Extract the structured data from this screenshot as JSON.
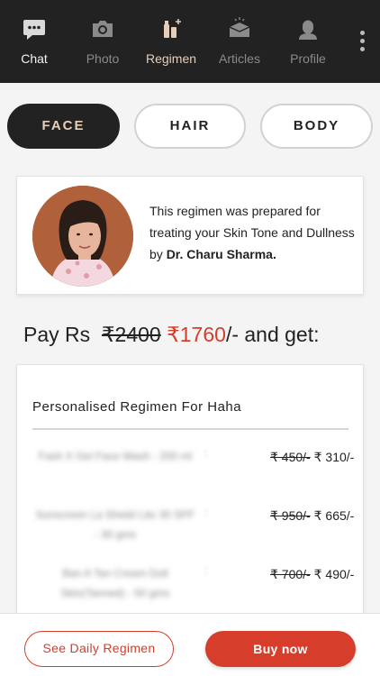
{
  "topnav": {
    "items": [
      {
        "label": "Chat",
        "icon": "chat-icon",
        "active": false
      },
      {
        "label": "Photo",
        "icon": "camera-icon",
        "active": false
      },
      {
        "label": "Regimen",
        "icon": "regimen-icon",
        "active": true
      },
      {
        "label": "Articles",
        "icon": "articles-icon",
        "active": false
      },
      {
        "label": "Profile",
        "icon": "profile-icon",
        "active": false
      }
    ],
    "menu_icon": "kebab-menu-icon"
  },
  "tabs": [
    {
      "label": "FACE",
      "selected": true
    },
    {
      "label": "HAIR",
      "selected": false
    },
    {
      "label": "BODY",
      "selected": false
    }
  ],
  "doctor": {
    "text_prefix": "This regimen was prepared for treating your Skin Tone and Dullness by ",
    "name": "Dr. Charu Sharma."
  },
  "price": {
    "prefix": "Pay Rs",
    "old": "₹2400",
    "new": "₹1760",
    "suffix": "/- and get:"
  },
  "regimen": {
    "title": "Personalised Regimen For Haha",
    "items": [
      {
        "name": "Fash X Gel Face Wash - 200 ml",
        "colon": ":",
        "old_price": "₹ 450/-",
        "new_price": "₹ 310/-"
      },
      {
        "name": "Sunscreen La Shield Lite 30 SPF - 30 gms",
        "colon": ":",
        "old_price": "₹ 950/-",
        "new_price": "₹ 665/-"
      },
      {
        "name": "Ban A Tan Cream Dull Skin(Tanned) - 50 gms",
        "colon": ":",
        "old_price": "₹ 700/-",
        "new_price": "₹ 490/-"
      }
    ]
  },
  "actions": {
    "secondary": "See Daily Regimen",
    "primary": "Buy now"
  },
  "colors": {
    "nav_bg": "#222222",
    "active_tab_text": "#e8cdb7",
    "accent_red": "#d63d2b"
  }
}
